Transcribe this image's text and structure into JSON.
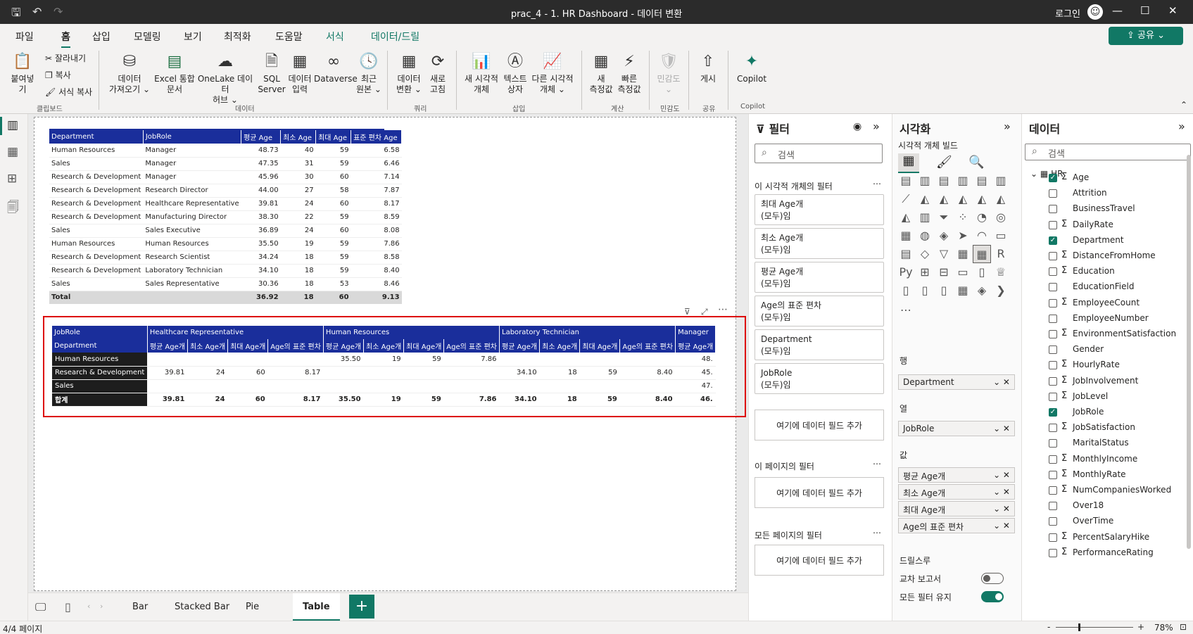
{
  "window": {
    "title": "prac_4 - 1. HR Dashboard - 데이터 변환",
    "user_label": "로그인"
  },
  "menu": {
    "tabs": [
      "파일",
      "홈",
      "삽입",
      "모델링",
      "보기",
      "최적화",
      "도움말",
      "서식",
      "데이터/드릴"
    ],
    "active": "홈",
    "share_label": "공유"
  },
  "ribbon": {
    "paste": "붙여넣기",
    "cut": "잘라내기",
    "copy": "복사",
    "format_copy": "서식 복사",
    "get_data": [
      "데이터",
      "가져오기"
    ],
    "excel": [
      "Excel 통합",
      "문서"
    ],
    "onelake": [
      "OneLake 데이터",
      "허브"
    ],
    "sql": [
      "SQL",
      "Server"
    ],
    "enter_data": [
      "데이터",
      "입력"
    ],
    "dataverse": "Dataverse",
    "recent": [
      "최근",
      "원본"
    ],
    "transform": [
      "데이터",
      "변환"
    ],
    "refresh": [
      "새로",
      "고침"
    ],
    "new_visual": [
      "새 시각적",
      "개체"
    ],
    "textbox": [
      "텍스트",
      "상자"
    ],
    "more_visuals": [
      "다른 시각적",
      "개체"
    ],
    "new_measure": [
      "새",
      "측정값"
    ],
    "quick_measure": [
      "빠른",
      "측정값"
    ],
    "sensitivity": "민감도",
    "publish": "게시",
    "copilot": "Copilot",
    "groups": [
      "클립보드",
      "데이터",
      "쿼리",
      "삽입",
      "계산",
      "민감도",
      "공유",
      "Copilot"
    ]
  },
  "table1": {
    "headers": [
      "Department",
      "JobRole",
      "평균 Age",
      "최소 Age",
      "최대 Age",
      "표준 편차 Age"
    ],
    "rows": [
      [
        "Human Resources",
        "Manager",
        "48.73",
        "40",
        "59",
        "6.58"
      ],
      [
        "Sales",
        "Manager",
        "47.35",
        "31",
        "59",
        "6.46"
      ],
      [
        "Research & Development",
        "Manager",
        "45.96",
        "30",
        "60",
        "7.14"
      ],
      [
        "Research & Development",
        "Research Director",
        "44.00",
        "27",
        "58",
        "7.87"
      ],
      [
        "Research & Development",
        "Healthcare Representative",
        "39.81",
        "24",
        "60",
        "8.17"
      ],
      [
        "Research & Development",
        "Manufacturing Director",
        "38.30",
        "22",
        "59",
        "8.59"
      ],
      [
        "Sales",
        "Sales Executive",
        "36.89",
        "24",
        "60",
        "8.08"
      ],
      [
        "Human Resources",
        "Human Resources",
        "35.50",
        "19",
        "59",
        "7.86"
      ],
      [
        "Research & Development",
        "Research Scientist",
        "34.24",
        "18",
        "59",
        "8.58"
      ],
      [
        "Research & Development",
        "Laboratory Technician",
        "34.10",
        "18",
        "59",
        "8.40"
      ],
      [
        "Sales",
        "Sales Representative",
        "30.36",
        "18",
        "53",
        "8.46"
      ]
    ],
    "total": [
      "Total",
      "",
      "36.92",
      "18",
      "60",
      "9.13"
    ]
  },
  "matrix": {
    "row_header": "JobRole",
    "col_header": "Department",
    "groups": [
      "Healthcare Representative",
      "Human Resources",
      "Laboratory Technician",
      "Manager"
    ],
    "measures": [
      "평균 Age개",
      "최소 Age개",
      "최대 Age개",
      "Age의 표준 편차"
    ],
    "rows": [
      {
        "label": "Human Resources",
        "values": [
          "",
          "",
          "",
          "",
          "35.50",
          "19",
          "59",
          "7.86",
          "",
          "",
          "",
          "",
          "48."
        ]
      },
      {
        "label": "Research & Development",
        "values": [
          "39.81",
          "24",
          "60",
          "8.17",
          "",
          "",
          "",
          "",
          "34.10",
          "18",
          "59",
          "8.40",
          "45."
        ]
      },
      {
        "label": "Sales",
        "values": [
          "",
          "",
          "",
          "",
          "",
          "",
          "",
          "",
          "",
          "",
          "",
          "",
          "47."
        ]
      }
    ],
    "total": {
      "label": "합계",
      "values": [
        "39.81",
        "24",
        "60",
        "8.17",
        "35.50",
        "19",
        "59",
        "7.86",
        "34.10",
        "18",
        "59",
        "8.40",
        "46."
      ]
    }
  },
  "page_tabs": {
    "tabs": [
      "Bar",
      "Stacked Bar",
      "Pie",
      "Table"
    ],
    "active": "Table"
  },
  "status": {
    "page": "4/4 페이지",
    "zoom": "78%"
  },
  "filters": {
    "title": "필터",
    "search_placeholder": "검색",
    "visual_section": "이 시각적 개체의 필터",
    "cards": [
      [
        "최대 Age개",
        "(모두)임"
      ],
      [
        "최소 Age개",
        "(모두)임"
      ],
      [
        "평균 Age개",
        "(모두)임"
      ],
      [
        "Age의 표준 편차",
        "(모두)임"
      ],
      [
        "Department",
        "(모두)임"
      ],
      [
        "JobRole",
        "(모두)임"
      ]
    ],
    "add_field": "여기에 데이터 필드 추가",
    "page_section": "이 페이지의 필터",
    "all_section": "모든 페이지의 필터"
  },
  "visualizations": {
    "title": "시각화",
    "build_label": "시각적 개체 빌드",
    "rows_label": "행",
    "rows_field": "Department",
    "cols_label": "열",
    "cols_field": "JobRole",
    "values_label": "값",
    "values_fields": [
      "평균 Age개",
      "최소 Age개",
      "최대 Age개",
      "Age의 표준 편차"
    ],
    "drill_label": "드릴스루",
    "cross_report": "교차 보고서",
    "keep_filters": "모든 필터 유지"
  },
  "data": {
    "title": "데이터",
    "search_placeholder": "검색",
    "table": "HR",
    "fields": [
      {
        "name": "Age",
        "sigma": true,
        "checked": true
      },
      {
        "name": "Attrition",
        "sigma": false,
        "checked": false
      },
      {
        "name": "BusinessTravel",
        "sigma": false,
        "checked": false
      },
      {
        "name": "DailyRate",
        "sigma": true,
        "checked": false
      },
      {
        "name": "Department",
        "sigma": false,
        "checked": true
      },
      {
        "name": "DistanceFromHome",
        "sigma": true,
        "checked": false
      },
      {
        "name": "Education",
        "sigma": true,
        "checked": false
      },
      {
        "name": "EducationField",
        "sigma": false,
        "checked": false
      },
      {
        "name": "EmployeeCount",
        "sigma": true,
        "checked": false
      },
      {
        "name": "EmployeeNumber",
        "sigma": false,
        "checked": false
      },
      {
        "name": "EnvironmentSatisfaction",
        "sigma": true,
        "checked": false
      },
      {
        "name": "Gender",
        "sigma": false,
        "checked": false
      },
      {
        "name": "HourlyRate",
        "sigma": true,
        "checked": false
      },
      {
        "name": "JobInvolvement",
        "sigma": true,
        "checked": false
      },
      {
        "name": "JobLevel",
        "sigma": true,
        "checked": false
      },
      {
        "name": "JobRole",
        "sigma": false,
        "checked": true
      },
      {
        "name": "JobSatisfaction",
        "sigma": true,
        "checked": false
      },
      {
        "name": "MaritalStatus",
        "sigma": false,
        "checked": false
      },
      {
        "name": "MonthlyIncome",
        "sigma": true,
        "checked": false
      },
      {
        "name": "MonthlyRate",
        "sigma": true,
        "checked": false
      },
      {
        "name": "NumCompaniesWorked",
        "sigma": true,
        "checked": false
      },
      {
        "name": "Over18",
        "sigma": false,
        "checked": false
      },
      {
        "name": "OverTime",
        "sigma": false,
        "checked": false
      },
      {
        "name": "PercentSalaryHike",
        "sigma": true,
        "checked": false
      },
      {
        "name": "PerformanceRating",
        "sigma": true,
        "checked": false
      }
    ]
  }
}
